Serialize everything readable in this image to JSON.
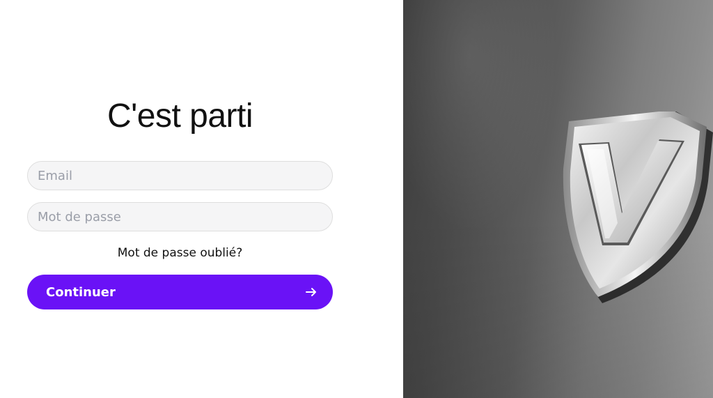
{
  "form": {
    "title": "C'est parti",
    "email_placeholder": "Email",
    "password_placeholder": "Mot de passe",
    "forgot_password_label": "Mot de passe oublié?",
    "continue_label": "Continuer",
    "continue_icon": "arrow-right-icon"
  },
  "hero": {
    "logo": "shield-v-logo",
    "logo_letter": "V"
  },
  "colors": {
    "accent": "#6a12f6",
    "input_background": "#f5f5f6",
    "input_border": "#dedede",
    "placeholder": "#9a9ea8",
    "text": "#111111",
    "hero_dark": "#3c3c3c",
    "hero_light": "#a6a6a6"
  }
}
